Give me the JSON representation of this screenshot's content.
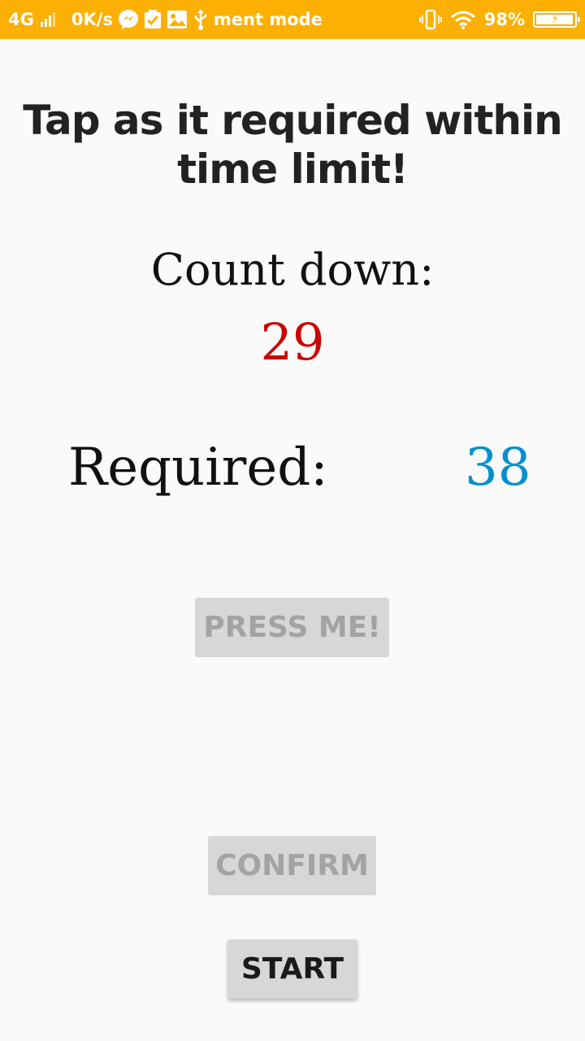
{
  "statusbar": {
    "network": "4G",
    "speed": "0K/s",
    "notification_text": "ment mode",
    "battery": "98%",
    "icons": [
      "signal-icon",
      "messenger-icon",
      "check-icon",
      "gallery-icon",
      "usb-icon",
      "vibrate-icon",
      "wifi-icon",
      "battery-charging-icon"
    ]
  },
  "main": {
    "title": "Tap as it required within time limit!",
    "countdown_label": "Count down:",
    "countdown_value": "29",
    "required_label": "Required:",
    "required_value": "38"
  },
  "buttons": {
    "press_label": "PRESS ME!",
    "confirm_label": "CONFIRM",
    "start_label": "START"
  },
  "colors": {
    "statusbar": "#fbb003",
    "countdown": "#cc0000",
    "required": "#0590cc",
    "button_bg": "#d6d7d7"
  }
}
